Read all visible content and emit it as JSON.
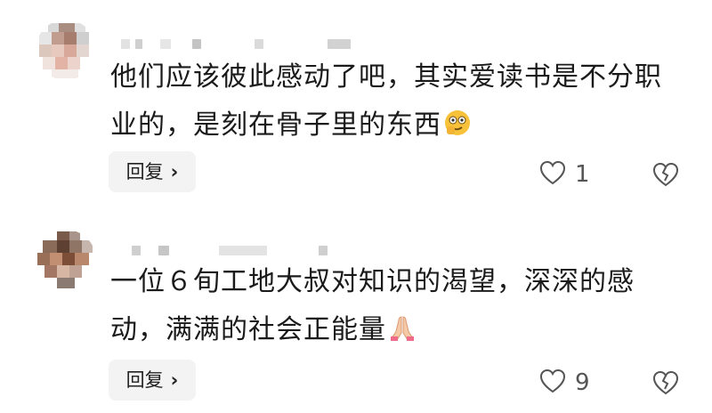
{
  "comments": [
    {
      "text": "他们应该彼此感动了吧，其实爱读书是不分职业的，是刻在骨子里的东西",
      "emoji": "thinking-face-emoji",
      "reply_label": "回复",
      "likes": "1"
    },
    {
      "text": "一位６旬工地大叔对知识的渴望，深深的感动，满满的社会正能量",
      "emoji": "folded-hands-emoji",
      "reply_label": "回复",
      "likes": "9"
    }
  ],
  "colors": {
    "mosaic_a": "#c9a79a",
    "mosaic_b": "#7a5a4a",
    "text": "#1a1a1a",
    "button_bg": "#f3f3f3"
  }
}
